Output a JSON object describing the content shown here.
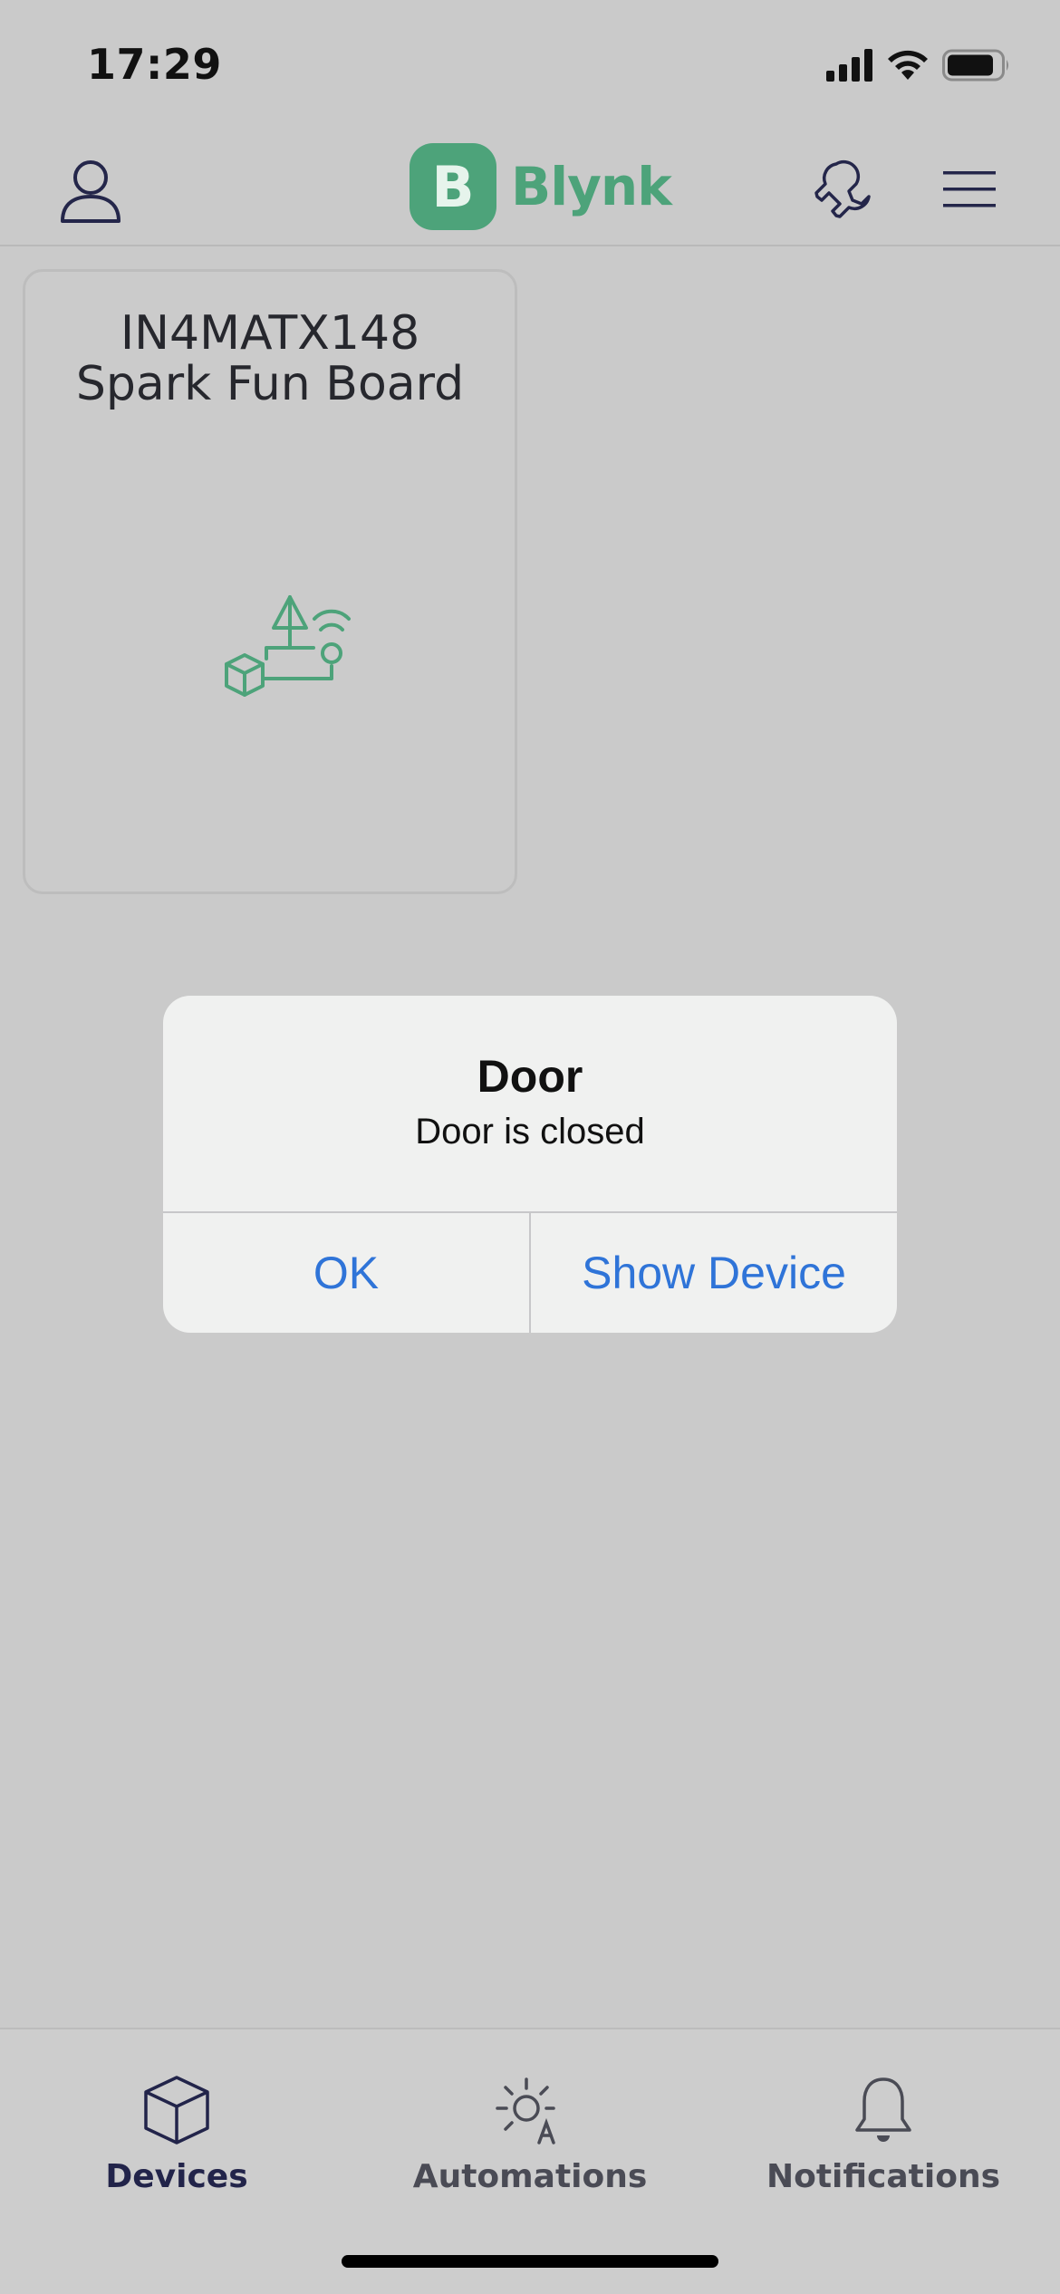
{
  "status_bar": {
    "time": "17:29",
    "icons": [
      "cellular-signal-icon",
      "wifi-icon",
      "battery-icon"
    ]
  },
  "header": {
    "logo_mark": "B",
    "logo_text": "Blynk",
    "icons": [
      "profile-icon",
      "wrench-icon",
      "menu-icon"
    ]
  },
  "device_card": {
    "title": "IN4MATX148\nSpark Fun Board",
    "icon": "device-template-icon"
  },
  "alert": {
    "title": "Door",
    "message": "Door is closed",
    "ok_label": "OK",
    "show_device_label": "Show Device"
  },
  "tabbar": {
    "tabs": [
      {
        "label": "Devices",
        "icon": "cube-icon",
        "active": true
      },
      {
        "label": "Automations",
        "icon": "automation-sun-icon",
        "active": false
      },
      {
        "label": "Notifications",
        "icon": "bell-icon",
        "active": false
      }
    ]
  },
  "colors": {
    "background": "#cacaca",
    "brand_green": "#4da37a",
    "link_blue": "#2f74d8",
    "active_tab": "#22244a",
    "inactive_tab": "#4a4b55"
  }
}
